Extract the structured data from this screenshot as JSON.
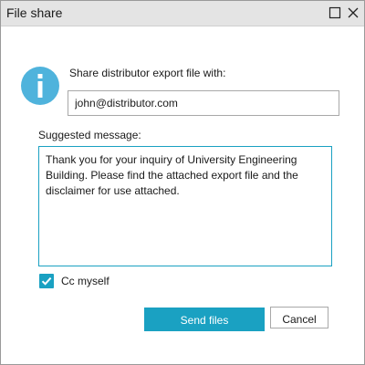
{
  "window": {
    "title": "File share"
  },
  "icons": {
    "info": "info-icon",
    "maximize": "maximize-icon",
    "close": "close-icon",
    "check": "check-icon"
  },
  "form": {
    "share_label": "Share distributor export file with:",
    "email_value": "john@distributor.com",
    "message_label": "Suggested message:",
    "message_value": "Thank you for your inquiry of University Engineering Building. Please find the attached export file and the disclaimer for use attached.",
    "cc_label": "Cc myself",
    "cc_checked": true
  },
  "buttons": {
    "send_label": "Send files",
    "cancel_label": "Cancel"
  },
  "colors": {
    "accent": "#1aa1c2",
    "info_icon": "#4fb3dc",
    "titlebar": "#e4e4e4"
  }
}
